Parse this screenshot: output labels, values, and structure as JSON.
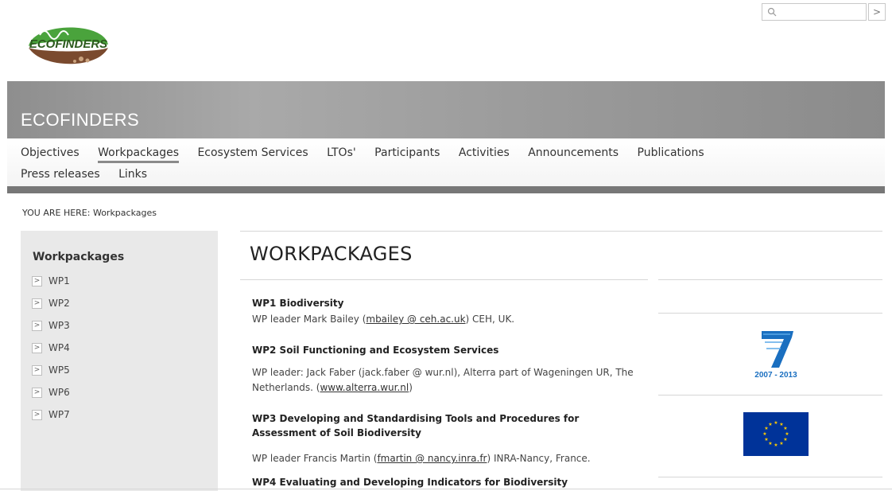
{
  "header": {
    "logo_text": "ECOFINDERS",
    "search": {
      "placeholder": "",
      "go_label": ">"
    }
  },
  "banner": {
    "site_title": "ECOFINDERS"
  },
  "nav": {
    "row1": [
      "Objectives",
      "Workpackages",
      "Ecosystem Services",
      "LTOs'",
      "Participants",
      "Activities",
      "Announcements",
      "Publications"
    ],
    "row2": [
      "Press releases",
      "Links"
    ],
    "active": "Workpackages"
  },
  "breadcrumb": "YOU ARE HERE: Workpackages",
  "sidebar": {
    "title": "Workpackages",
    "items": [
      "WP1",
      "WP2",
      "WP3",
      "WP4",
      "WP5",
      "WP6",
      "WP7"
    ],
    "arrow": ">"
  },
  "main": {
    "title": "WORKPACKAGES",
    "wp1": {
      "title": "WP1 Biodiversity",
      "text_pre": "WP leader Mark Bailey (",
      "link": "mbailey @ ceh.ac.uk",
      "text_post": ") CEH, UK."
    },
    "wp2": {
      "title": "WP2 Soil Functioning and Ecosystem Services",
      "text_pre": "WP leader: Jack Faber (jack.faber @ wur.nl), Alterra part of Wageningen UR, The Netherlands. (",
      "link": "www.alterra.wur.nl",
      "text_post": ")"
    },
    "wp3": {
      "title": "WP3 Developing and Standardising Tools and Procedures for Assessment of Soil Biodiversity",
      "text_pre": "WP leader Francis Martin (",
      "link": "fmartin @ nancy.inra.fr",
      "text_post": ") INRA-Nancy, France."
    },
    "wp4": {
      "title": "WP4 Evaluating and Developing Indicators for Biodiversity"
    }
  },
  "right_column": {
    "fp7_caption": "2007 - 2013"
  },
  "colors": {
    "banner": "#9b9b9b",
    "sidebar": "#e9e9e9",
    "eu_blue": "#003399",
    "eu_star": "#ffcc00",
    "fp7_blue": "#1a6fc0",
    "logo_green": "#4aa33c",
    "logo_brown": "#7a4a2e"
  }
}
